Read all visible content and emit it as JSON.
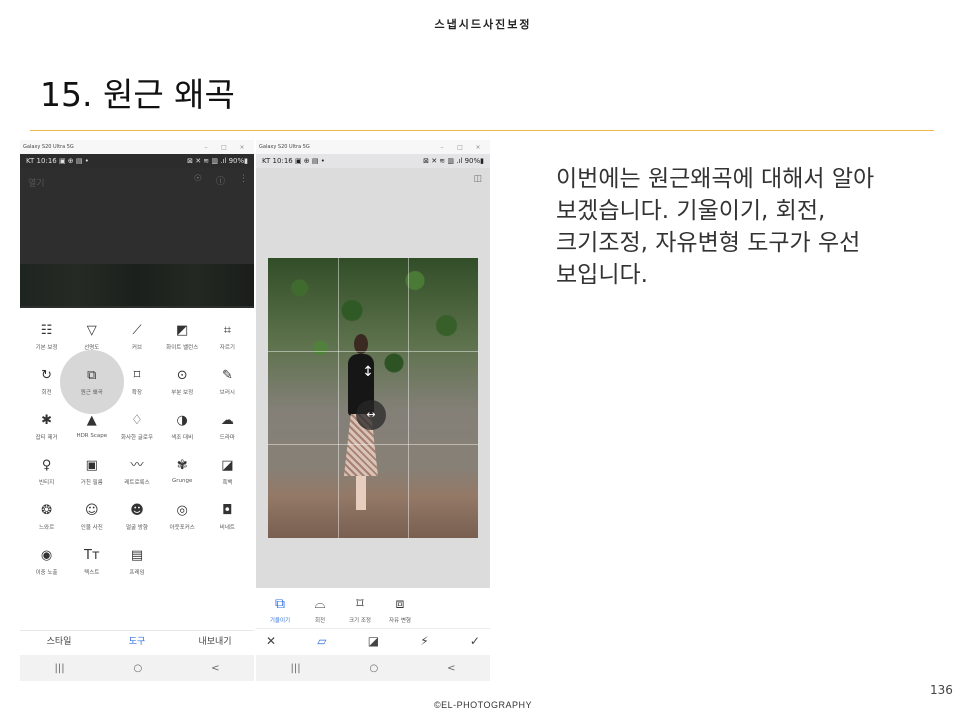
{
  "header_title": "스냅시드사진보정",
  "slide_title": "15. 원근 왜곡",
  "description_lines": [
    "이번에는 원근왜곡에 대해서 알아",
    "보겠습니다. 기울이기, 회전,",
    "크기조정, 자유변형 도구가 우선",
    "보입니다."
  ],
  "page_number": "136",
  "footer": "©EL-PHOTOGRAPHY",
  "colors": {
    "accent_line": "#f0b84a",
    "active_blue": "#2f6fe0"
  },
  "left_phone": {
    "window_title": "Galaxy S20 Ultra 5G",
    "window_controls": [
      "–",
      "□",
      "×"
    ],
    "status_left": "KT 10:16 ▣ ⊕ ▤ •",
    "status_right": "⊠ ✕ ≋ ▥ .ıl 90%▮",
    "open_label": "열기",
    "top_icons": [
      "☉",
      "ⓘ",
      "⋮"
    ],
    "tools": [
      {
        "icon": "☷",
        "label": "기본 보정",
        "name": "tune-image-icon"
      },
      {
        "icon": "▽",
        "label": "선명도",
        "name": "details-icon"
      },
      {
        "icon": "⟋",
        "label": "커브",
        "name": "curves-icon"
      },
      {
        "icon": "◩",
        "label": "화이트 밸런스",
        "name": "white-balance-icon"
      },
      {
        "icon": "⌗",
        "label": "자르기",
        "name": "crop-icon"
      },
      {
        "icon": "↻",
        "label": "회전",
        "name": "rotate-icon"
      },
      {
        "icon": "⧉",
        "label": "원근 왜곡",
        "name": "perspective-icon",
        "active": true
      },
      {
        "icon": "⌑",
        "label": "확장",
        "name": "expand-icon"
      },
      {
        "icon": "⊙",
        "label": "부분 보정",
        "name": "selective-icon"
      },
      {
        "icon": "✎",
        "label": "브러시",
        "name": "brush-icon"
      },
      {
        "icon": "✱",
        "label": "잡티 제거",
        "name": "healing-icon"
      },
      {
        "icon": "▲",
        "label": "HDR Scape",
        "name": "hdr-icon"
      },
      {
        "icon": "♢",
        "label": "화사한 글로우",
        "name": "glamour-glow-icon"
      },
      {
        "icon": "◑",
        "label": "색조 대비",
        "name": "tonal-contrast-icon"
      },
      {
        "icon": "☁",
        "label": "드라마",
        "name": "drama-icon"
      },
      {
        "icon": "♀",
        "label": "빈티지",
        "name": "vintage-icon"
      },
      {
        "icon": "▣",
        "label": "거친 필름",
        "name": "grainy-film-icon"
      },
      {
        "icon": "〰",
        "label": "레트로룩스",
        "name": "retrolux-icon"
      },
      {
        "icon": "✾",
        "label": "Grunge",
        "name": "grunge-icon"
      },
      {
        "icon": "◪",
        "label": "흑백",
        "name": "black-white-icon"
      },
      {
        "icon": "❂",
        "label": "느와르",
        "name": "noir-icon"
      },
      {
        "icon": "☺",
        "label": "인물 사진",
        "name": "portrait-icon"
      },
      {
        "icon": "☻",
        "label": "얼굴 방향",
        "name": "head-pose-icon"
      },
      {
        "icon": "◎",
        "label": "아웃포커스",
        "name": "lens-blur-icon"
      },
      {
        "icon": "◘",
        "label": "비네트",
        "name": "vignette-icon"
      },
      {
        "icon": "◉",
        "label": "이중 노출",
        "name": "double-exposure-icon"
      },
      {
        "icon": "Tт",
        "label": "텍스트",
        "name": "text-icon"
      },
      {
        "icon": "▤",
        "label": "프레임",
        "name": "frames-icon"
      }
    ],
    "bottom_tabs": [
      "스타일",
      "도구",
      "내보내기"
    ],
    "active_tab_index": 1,
    "nav": [
      "|||",
      "○",
      "<"
    ]
  },
  "right_phone": {
    "window_title": "Galaxy S20 Ultra 5G",
    "window_controls": [
      "–",
      "□",
      "×"
    ],
    "status_left": "KT 10:16 ▣ ⊕ ▤ •",
    "status_right": "⊠ ✕ ≋ ▥ .ıl 90%▮",
    "compare_icon": "◫",
    "handle_vertical": "↕",
    "handle_horizontal": "↔",
    "perspective_tools": [
      {
        "icon": "⧉",
        "label": "기울이기",
        "name": "tilt-icon",
        "active": true
      },
      {
        "icon": "⌓",
        "label": "회전",
        "name": "rotate-icon"
      },
      {
        "icon": "⌑",
        "label": "크기 조정",
        "name": "scale-icon"
      },
      {
        "icon": "⧈",
        "label": "자유 변형",
        "name": "free-icon"
      }
    ],
    "actions": [
      "✕",
      "▱",
      "◪",
      "⚡",
      "✓"
    ],
    "nav": [
      "|||",
      "○",
      "<"
    ]
  }
}
